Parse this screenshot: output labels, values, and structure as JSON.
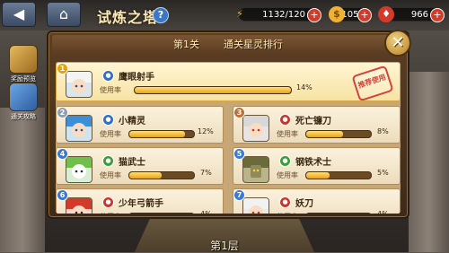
{
  "topbar": {
    "back_icon": "back-arrow-icon",
    "home_icon": "home-icon",
    "title": "试炼之塔",
    "help": "?",
    "resources": [
      {
        "name": "energy",
        "icon": "lightning-icon",
        "value": "1132/120",
        "color": "#f2c23a"
      },
      {
        "name": "gold",
        "icon": "coin-icon",
        "value": "1105k",
        "color": "#f0b232"
      },
      {
        "name": "gems",
        "icon": "gem-icon",
        "value": "966",
        "color": "#d23a2a"
      }
    ]
  },
  "side": [
    {
      "label": "奖励预览",
      "icon": "reward-scroll-icon"
    },
    {
      "label": "通关攻略",
      "icon": "strategy-book-icon"
    }
  ],
  "panel": {
    "level": "第1关",
    "title": "通关星灵排行",
    "usage_label": "使用率",
    "recommend_stamp": "推荐使用"
  },
  "ranking": [
    {
      "rank": "1",
      "name": "鹰眼射手",
      "class": "blue",
      "usage_percent": 14,
      "usage_text": "14%",
      "avatar_color": "#d9e6ef",
      "avatar_hair": "#f4f4f4"
    },
    {
      "rank": "2",
      "name": "小精灵",
      "class": "blue",
      "usage_percent": 12,
      "usage_text": "12%",
      "avatar_color": "#cfe4f3",
      "avatar_hair": "#3b8fd8"
    },
    {
      "rank": "3",
      "name": "死亡镰刀",
      "class": "red",
      "usage_percent": 8,
      "usage_text": "8%",
      "avatar_color": "#e9e4e4",
      "avatar_hair": "#d8d8d8"
    },
    {
      "rank": "4",
      "name": "猫武士",
      "class": "green",
      "usage_percent": 7,
      "usage_text": "7%",
      "avatar_color": "#d9efd4",
      "avatar_hair": "#6fbf4a"
    },
    {
      "rank": "5",
      "name": "钢铁术士",
      "class": "green",
      "usage_percent": 5,
      "usage_text": "5%",
      "avatar_color": "#b9b48a",
      "avatar_hair": "#6a6a3a"
    },
    {
      "rank": "6",
      "name": "少年弓箭手",
      "class": "red",
      "usage_percent": 4,
      "usage_text": "4%",
      "avatar_color": "#f3d9d2",
      "avatar_hair": "#d23a2a"
    },
    {
      "rank": "7",
      "name": "妖刀",
      "class": "red",
      "usage_percent": 4,
      "usage_text": "4%",
      "avatar_color": "#eee8e8",
      "avatar_hair": "#f2f2f2"
    }
  ],
  "floor_label": "第1层"
}
